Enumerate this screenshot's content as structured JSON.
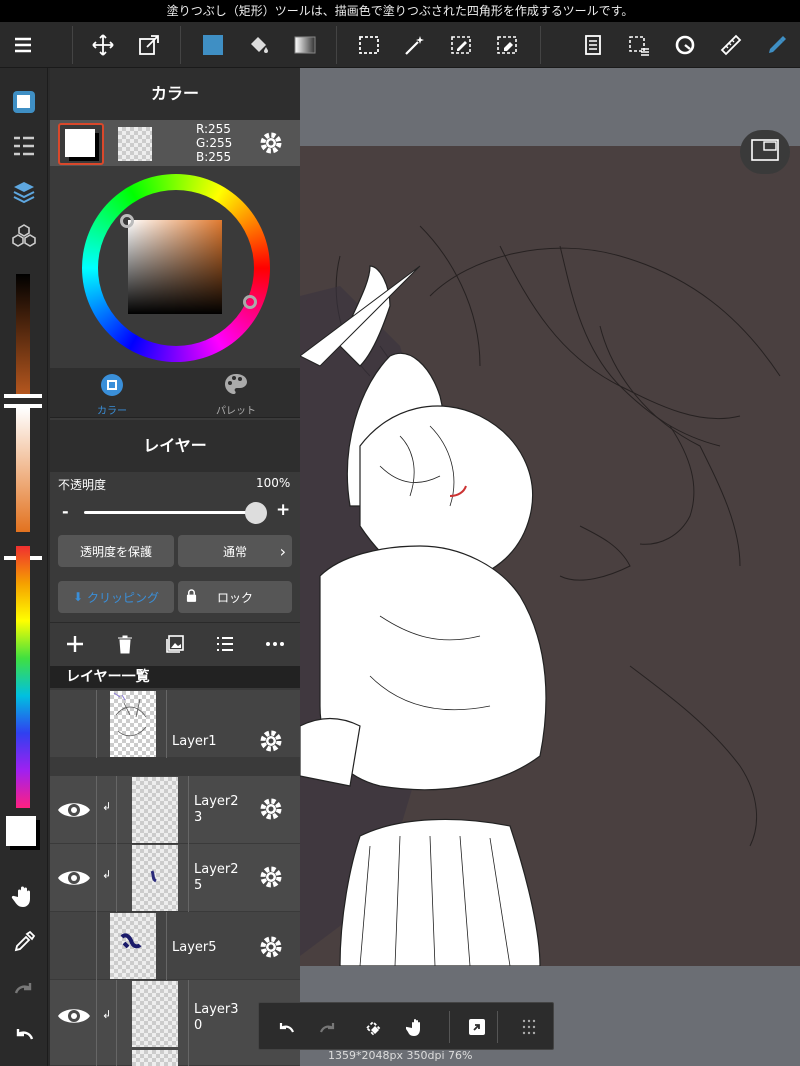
{
  "hint": "塗りつぶし（矩形）ツールは、描画色で塗りつぶされた四角形を作成するツールです。",
  "color_panel": {
    "title": "カラー",
    "r": "R:255",
    "g": "G:255",
    "b": "B:255",
    "tab_color": "カラー",
    "tab_palette": "パレット",
    "accent": "#3a8fd9"
  },
  "layer_panel": {
    "title": "レイヤー",
    "opacity_label": "不透明度",
    "opacity_value": "100%",
    "opacity_fraction": 1.0,
    "protect_label": "透明度を保護",
    "blend_label": "通常",
    "clipping_label": "クリッピング",
    "lock_label": "ロック",
    "list_title": "レイヤー一覧",
    "minus": "-",
    "plus": "+",
    "layers": [
      {
        "name": "Layer1",
        "visible": false,
        "clipped": false
      },
      {
        "name": "Layer2\n3",
        "visible": true,
        "clipped": true
      },
      {
        "name": "Layer2\n5",
        "visible": true,
        "clipped": true
      },
      {
        "name": "Layer5",
        "visible": false,
        "clipped": false
      },
      {
        "name": "Layer3\n0",
        "visible": true,
        "clipped": true
      }
    ]
  },
  "status": "1359*2048px 350dpi 76%",
  "colors": {
    "toolbar_bg": "#2a2a2a",
    "panel_bg": "#3a3a3a",
    "canvas_bg": "#4a4040",
    "selected_swatch_border": "#d9482b"
  }
}
